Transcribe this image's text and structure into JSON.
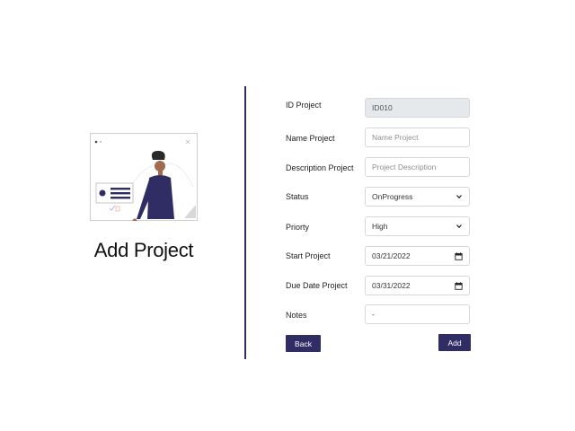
{
  "page": {
    "title": "Add Project"
  },
  "form": {
    "id_project": {
      "label": "ID Project",
      "value": "ID010"
    },
    "name_project": {
      "label": "Name Project",
      "placeholder": "Name Project"
    },
    "description_project": {
      "label": "Description Project",
      "placeholder": "Project Description"
    },
    "status": {
      "label": "Status",
      "value": "OnProgress"
    },
    "priority": {
      "label": "Priorty",
      "value": "High"
    },
    "start_project": {
      "label": "Start Project",
      "value": "03/21/2022"
    },
    "due_date_project": {
      "label": "Due Date Project",
      "value": "03/31/2022"
    },
    "notes": {
      "label": "Notes",
      "value": "-"
    }
  },
  "buttons": {
    "back": "Back",
    "add": "Add"
  },
  "colors": {
    "accent": "#2f2d64",
    "disabled_bg": "#e6e9ec",
    "border": "#d4d8dc"
  }
}
